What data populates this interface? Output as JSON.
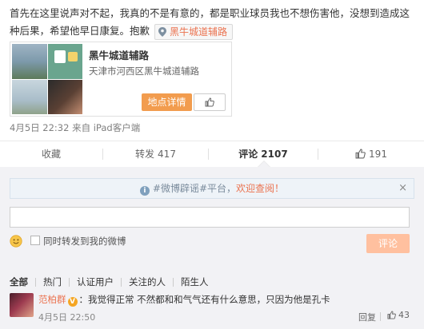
{
  "post": {
    "text": "首先在这里说声对不起，我真的不是有意的，都是职业球员我也不想伤害他，没想到造成这种后果，希望他早日康复。抱歉",
    "checkin_label": "黑牛城道辅路",
    "meta": "4月5日 22:32 来自 iPad客户端"
  },
  "place_card": {
    "name": "黑牛城道辅路",
    "address": "天津市河西区黑牛城道辅路",
    "detail_button": "地点详情"
  },
  "actions": {
    "favorite": "收藏",
    "forward": "转发",
    "forward_count": "417",
    "comment": "评论",
    "comment_count": "2107",
    "like_count": "191"
  },
  "comments": {
    "notice_text": "#微博辟谣#平台，",
    "notice_highlight": "欢迎查阅！",
    "notice_close": "×",
    "forward_label": "同时转发到我的微博",
    "submit_button": "评论",
    "filters": [
      "全部",
      "热门",
      "认证用户",
      "关注的人",
      "陌生人"
    ],
    "items": [
      {
        "author": "范柏群",
        "badge": "V",
        "text": "：我觉得正常 不然都和和气气还有什么意思，只因为他是孔卡",
        "time": "4月5日 22:50",
        "reply": "回复",
        "likes": "43"
      }
    ]
  },
  "colors": {
    "accent_orange": "#eb7350",
    "button_orange": "#f29c4e",
    "submit_disabled": "#ffc09f",
    "panel_bg": "#f2f2f5"
  },
  "icons": {
    "checkin": "location-pin-icon",
    "like": "thumbs-up-icon",
    "info": "info-circle-icon",
    "emoji": "smiley-icon"
  }
}
